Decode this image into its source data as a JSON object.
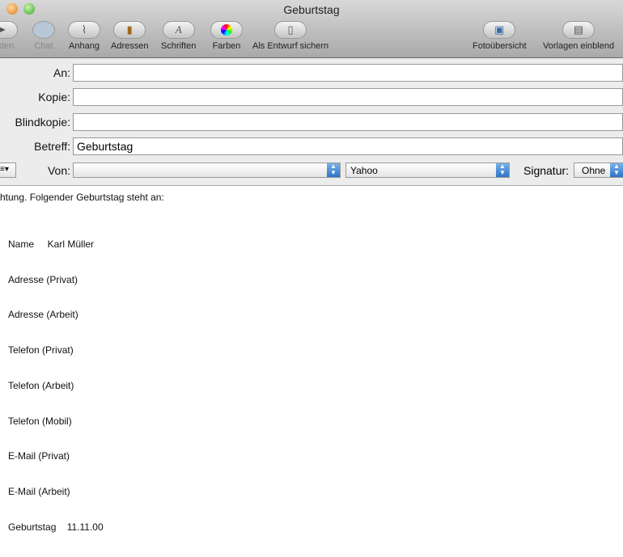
{
  "window": {
    "title": "Geburtstag"
  },
  "toolbar": {
    "items": [
      {
        "label": "enden",
        "icon": "send-icon"
      },
      {
        "label": "Chat",
        "icon": "chat-icon"
      },
      {
        "label": "Anhang",
        "icon": "paperclip-icon"
      },
      {
        "label": "Adressen",
        "icon": "address-book-icon"
      },
      {
        "label": "Schriften",
        "icon": "fonts-icon"
      },
      {
        "label": "Farben",
        "icon": "colors-icon"
      },
      {
        "label": "Als Entwurf sichern",
        "icon": "draft-icon"
      },
      {
        "label": "Fotoübersicht",
        "icon": "photo-icon"
      },
      {
        "label": "Vorlagen einblend",
        "icon": "templates-icon"
      }
    ]
  },
  "header": {
    "to_label": "An:",
    "to_value": "",
    "cc_label": "Kopie:",
    "cc_value": "",
    "bcc_label": "Blindkopie:",
    "bcc_value": "",
    "subject_label": "Betreff:",
    "subject_value": "Geburtstag",
    "from_label": "Von:",
    "from_value": "",
    "account": "Yahoo",
    "signature_label": "Signatur:",
    "signature_value": "Ohne"
  },
  "body": {
    "intro": "htung. Folgender Geburtstag steht an:",
    "lines": [
      "Name     Karl Müller",
      "Adresse (Privat)",
      "Adresse (Arbeit)",
      "Telefon (Privat)",
      "Telefon (Arbeit)",
      "Telefon (Mobil)",
      "E-Mail (Privat)",
      "E-Mail (Arbeit)",
      "Geburtstag    11.11.00"
    ]
  }
}
